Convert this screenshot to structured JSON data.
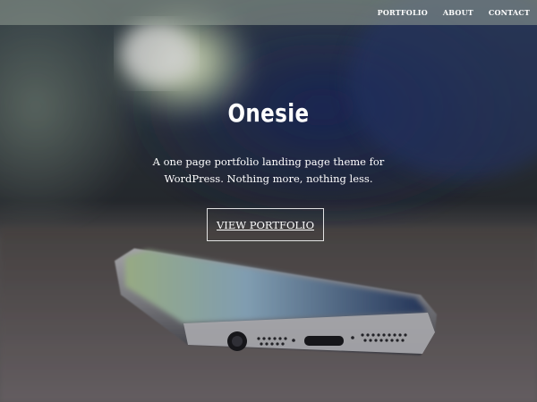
{
  "nav": {
    "items": [
      {
        "label": "PORTFOLIO"
      },
      {
        "label": "ABOUT"
      },
      {
        "label": "CONTACT"
      }
    ]
  },
  "hero": {
    "title": "Onesie",
    "tagline_line1": "A one page portfolio landing page theme for",
    "tagline_line2": "WordPress. Nothing more, nothing less.",
    "cta_label": "VIEW PORTFOLIO",
    "background_image": "blurred-smartphone-on-table"
  },
  "colors": {
    "text": "#ffffff",
    "topbar": "#98a098"
  }
}
